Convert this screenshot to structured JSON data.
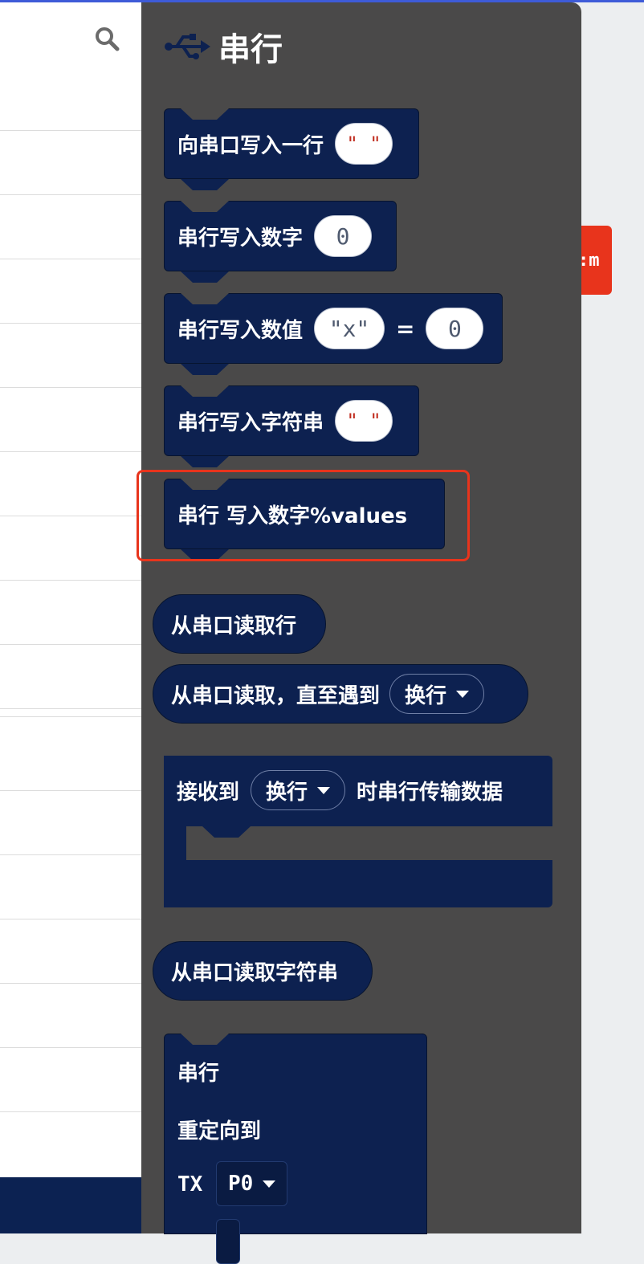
{
  "flyout": {
    "title": "串行",
    "icon": "usb-icon"
  },
  "blocks": {
    "write_line": {
      "label": "向串口写入一行",
      "value": "\" \""
    },
    "write_number": {
      "label": "串行写入数字",
      "value": "0"
    },
    "write_value": {
      "label": "串行写入数值",
      "key": "\"x\"",
      "eq": "=",
      "value": "0"
    },
    "write_string": {
      "label": "串行写入字符串",
      "value": "\" \""
    },
    "write_numbers": {
      "label": "串行 写入数字%values"
    },
    "read_line": {
      "label": "从串口读取行"
    },
    "read_until": {
      "label": "从串口读取，直至遇到",
      "option": "换行"
    },
    "on_data": {
      "prefix": "接收到",
      "option": "换行",
      "suffix": "时串行传输数据"
    },
    "read_string": {
      "label": "从串口读取字符串"
    },
    "redirect": {
      "line1": "串行",
      "line2": "重定向到",
      "tx_label": "TX",
      "tx_value": "P0"
    }
  },
  "colors": {
    "block_bg": "#0d2150",
    "flyout_bg": "#4a4949",
    "highlight": "#e8341c"
  }
}
